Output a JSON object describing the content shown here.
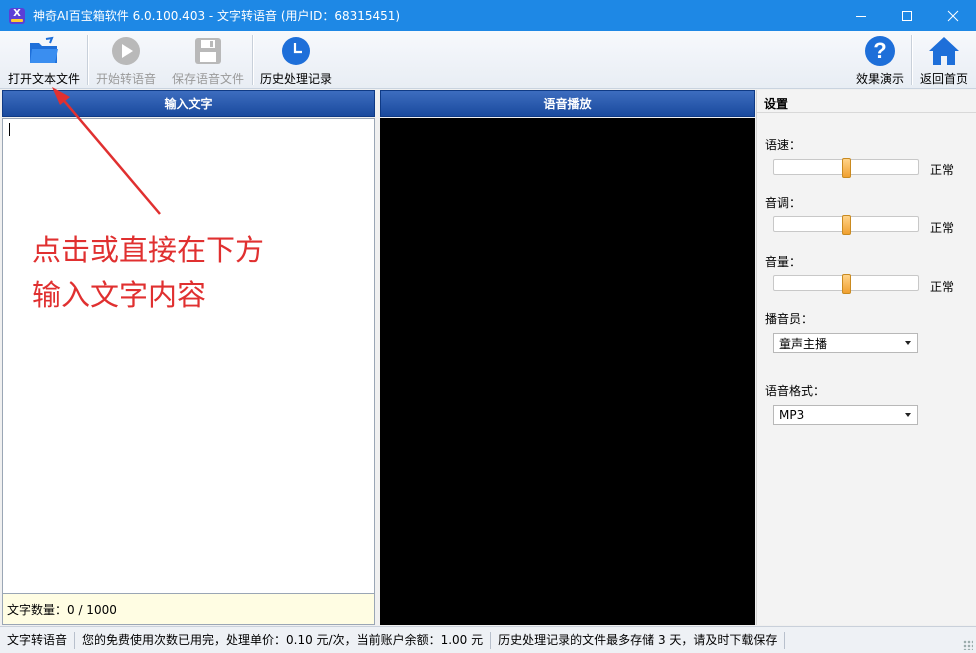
{
  "window": {
    "title": "神奇AI百宝箱软件 6.0.100.403 - 文字转语音 (用户ID：68315451)",
    "controls": {
      "minimize": "—",
      "maximize": "☐",
      "close": "✕"
    }
  },
  "toolbar": {
    "open_file": "打开文本文件",
    "start": "开始转语音",
    "save_audio": "保存语音文件",
    "history": "历史处理记录",
    "demo": "效果演示",
    "home": "返回首页"
  },
  "input_panel": {
    "header": "输入文字",
    "annotation_line1": "点击或直接在下方",
    "annotation_line2": "输入文字内容",
    "count": "文字数量：0 / 1000"
  },
  "player_panel": {
    "header": "语音播放"
  },
  "settings": {
    "title": "设置",
    "speed": {
      "label": "语速：",
      "value": "正常",
      "level": 0.5
    },
    "pitch": {
      "label": "音调：",
      "value": "正常",
      "level": 0.5
    },
    "volume": {
      "label": "音量：",
      "value": "正常",
      "level": 0.5
    },
    "voice": {
      "label": "播音员：",
      "selected": "童声主播"
    },
    "format": {
      "label": "语音格式：",
      "selected": "MP3"
    }
  },
  "statusbar": {
    "module": "文字转语音",
    "pricing": "您的免费使用次数已用完，处理单价：0.10 元/次，当前账户余额：1.00 元",
    "storage_note": "历史处理记录的文件最多存储 3 天，请及时下载保存"
  },
  "colors": {
    "titlebar": "#1e88e5",
    "panel_header": "#1a4a9e",
    "annotation": "#e03030",
    "accent_blue": "#1e6fd9"
  }
}
